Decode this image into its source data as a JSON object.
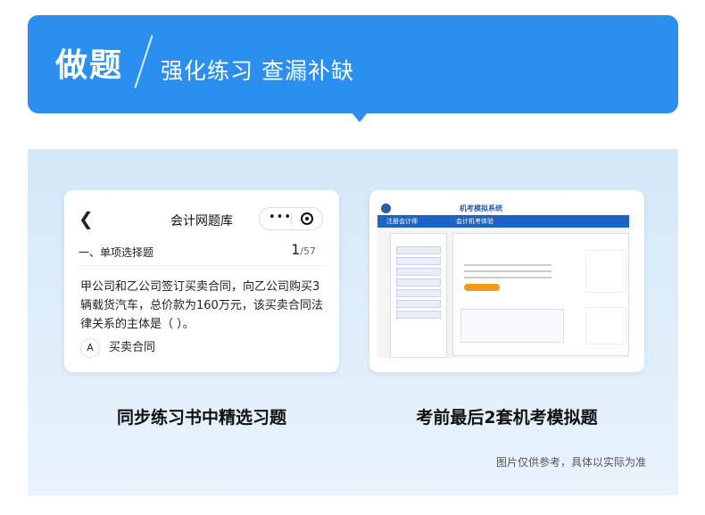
{
  "banner": {
    "title": "做题",
    "subtitle": "强化练习 查漏补缺"
  },
  "phone": {
    "nav_title": "会计网题库",
    "back_icon": "chevron-left-icon",
    "menu_icon": "more-dots-icon",
    "close_icon": "target-circle-icon",
    "section_label": "一、单项选择题",
    "current_index": "1",
    "total": "/57",
    "question_text": "甲公司和乙公司签订买卖合同，向乙公司购买3辆载货汽车，总价款为160万元，该买卖合同法律关系的主体是（ ）。",
    "option_letter": "A",
    "option_text": "买卖合同"
  },
  "desktop": {
    "system_title": "机考模拟系统",
    "nav_left": "注册会计师",
    "nav_right": "会计机考体验"
  },
  "captions": {
    "left": "同步练习书中精选习题",
    "right": "考前最后2套机考模拟题"
  },
  "footer_note": "图片仅供参考，具体以实际为准",
  "colors": {
    "banner_blue": "#2b8ff0",
    "panel_bg": "#d4e8f8"
  }
}
